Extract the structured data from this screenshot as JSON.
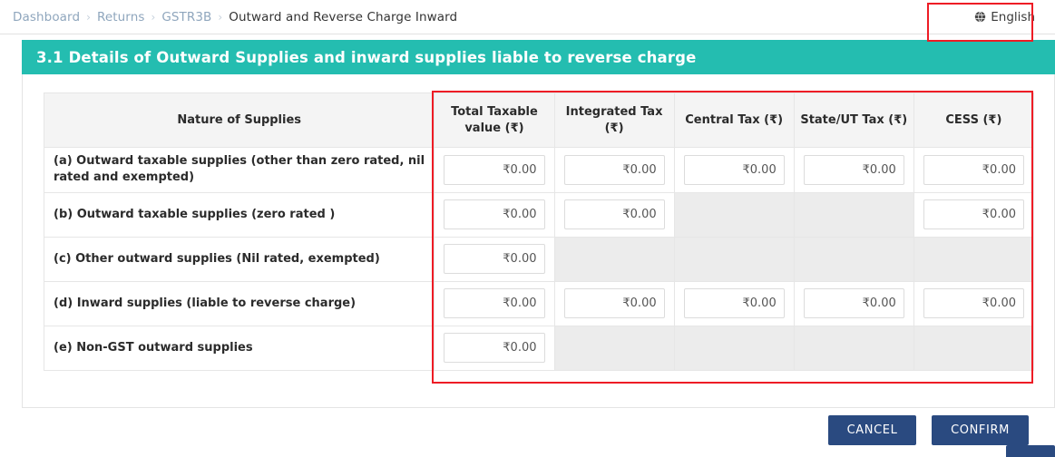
{
  "breadcrumb": {
    "items": [
      {
        "label": "Dashboard",
        "current": false
      },
      {
        "label": "Returns",
        "current": false
      },
      {
        "label": "GSTR3B",
        "current": false
      },
      {
        "label": "Outward and Reverse Charge Inward",
        "current": true
      }
    ],
    "separator": "›"
  },
  "language": {
    "icon": "globe-icon",
    "label": "English"
  },
  "section": {
    "title": "3.1 Details of Outward Supplies and inward supplies liable to reverse charge",
    "accent_color": "#24bdb0"
  },
  "table": {
    "headers": [
      "Nature of Supplies",
      "Total Taxable value (₹)",
      "Integrated Tax (₹)",
      "Central Tax (₹)",
      "State/UT Tax (₹)",
      "CESS (₹)"
    ],
    "rows": [
      {
        "label": "(a) Outward taxable supplies (other than zero rated, nil rated and exempted)",
        "cells": [
          {
            "enabled": true,
            "value": "₹0.00"
          },
          {
            "enabled": true,
            "value": "₹0.00"
          },
          {
            "enabled": true,
            "value": "₹0.00"
          },
          {
            "enabled": true,
            "value": "₹0.00"
          },
          {
            "enabled": true,
            "value": "₹0.00"
          }
        ]
      },
      {
        "label": "(b) Outward taxable supplies (zero rated )",
        "cells": [
          {
            "enabled": true,
            "value": "₹0.00"
          },
          {
            "enabled": true,
            "value": "₹0.00"
          },
          {
            "enabled": false,
            "value": ""
          },
          {
            "enabled": false,
            "value": ""
          },
          {
            "enabled": true,
            "value": "₹0.00"
          }
        ]
      },
      {
        "label": "(c) Other outward supplies (Nil rated, exempted)",
        "cells": [
          {
            "enabled": true,
            "value": "₹0.00"
          },
          {
            "enabled": false,
            "value": ""
          },
          {
            "enabled": false,
            "value": ""
          },
          {
            "enabled": false,
            "value": ""
          },
          {
            "enabled": false,
            "value": ""
          }
        ]
      },
      {
        "label": "(d) Inward supplies (liable to reverse charge)",
        "cells": [
          {
            "enabled": true,
            "value": "₹0.00"
          },
          {
            "enabled": true,
            "value": "₹0.00"
          },
          {
            "enabled": true,
            "value": "₹0.00"
          },
          {
            "enabled": true,
            "value": "₹0.00"
          },
          {
            "enabled": true,
            "value": "₹0.00"
          }
        ]
      },
      {
        "label": "(e) Non-GST outward supplies",
        "cells": [
          {
            "enabled": true,
            "value": "₹0.00"
          },
          {
            "enabled": false,
            "value": ""
          },
          {
            "enabled": false,
            "value": ""
          },
          {
            "enabled": false,
            "value": ""
          },
          {
            "enabled": false,
            "value": ""
          }
        ]
      }
    ]
  },
  "footer": {
    "cancel_label": "CANCEL",
    "confirm_label": "CONFIRM",
    "button_color": "#2a4a80",
    "highlight_color": "#ee1c25"
  }
}
